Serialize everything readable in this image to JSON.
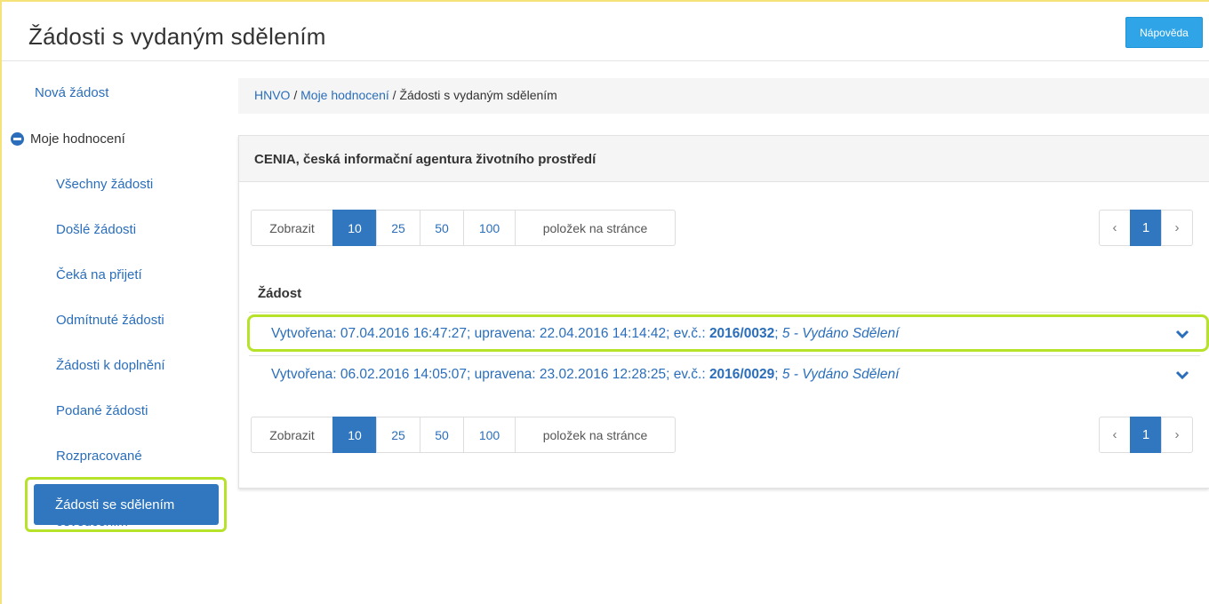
{
  "header": {
    "title": "Žádosti s vydaným sdělením",
    "help_label": "Nápověda"
  },
  "sidebar": {
    "new_request": "Nová žádost",
    "group_label": "Moje hodnocení",
    "items": [
      {
        "label": "Všechny žádosti"
      },
      {
        "label": "Došlé žádosti"
      },
      {
        "label": "Čeká na přijetí"
      },
      {
        "label": "Odmítnuté žádosti"
      },
      {
        "label": "Žádosti k doplnění"
      },
      {
        "label": "Podané žádosti"
      },
      {
        "label": "Rozpracované"
      },
      {
        "label": "Žádosti s osvědčením"
      }
    ],
    "active_item": "Žádosti se sdělením"
  },
  "breadcrumb": {
    "root": "HNVO",
    "parent": "Moje hodnocení",
    "current": "Žádosti s vydaným sdělením",
    "separator": "/"
  },
  "panel": {
    "heading": "CENIA, česká informační agentura životního prostředí",
    "page_size": {
      "prefix": "Zobrazit",
      "options": [
        "10",
        "25",
        "50",
        "100"
      ],
      "selected": "10",
      "suffix": "položek na stránce"
    },
    "pagination": {
      "prev": "‹",
      "current_page": "1",
      "next": "›"
    },
    "column_header": "Žádost",
    "rows": [
      {
        "created_label": "Vytvořena: ",
        "created": "07.04.2016 16:47:27",
        "updated_label": "; upravena: ",
        "updated": "22.04.2016 14:14:42",
        "ev_label": "; ev.č.: ",
        "ev_number": "2016/0032",
        "sep": "; ",
        "status": "5 - Vydáno Sdělení"
      },
      {
        "created_label": "Vytvořena: ",
        "created": "06.02.2016 14:05:07",
        "updated_label": "; upravena: ",
        "updated": "23.02.2016 12:28:25",
        "ev_label": "; ev.č.: ",
        "ev_number": "2016/0029",
        "sep": "; ",
        "status": "5 - Vydáno Sdělení"
      }
    ]
  },
  "colors": {
    "link_blue": "#2a6ebb",
    "active_blue": "#3077c0",
    "help_blue": "#2fa4e7",
    "highlight_green": "#b7e22a"
  },
  "icons": {
    "group_toggle": "minus-circle-icon",
    "row_expand": "chevron-down-icon"
  }
}
